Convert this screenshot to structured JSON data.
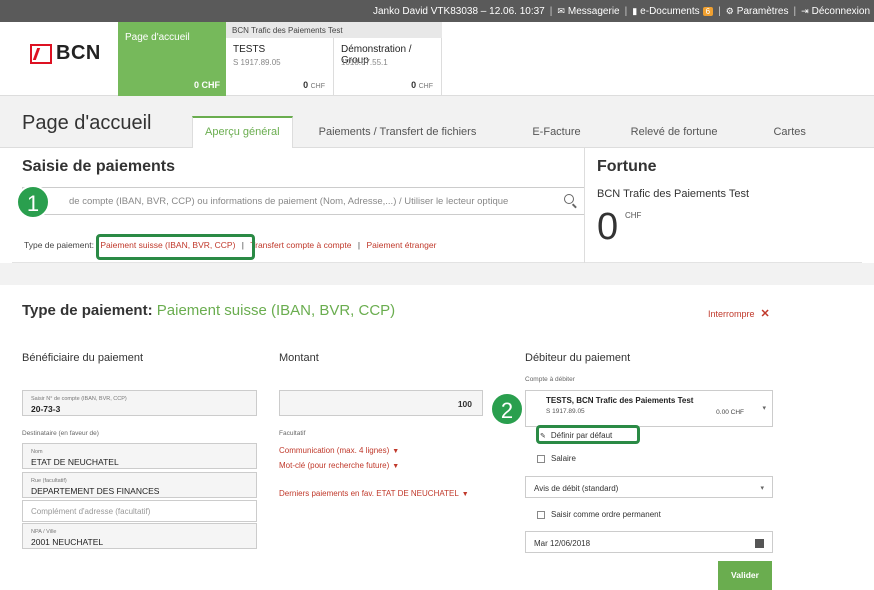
{
  "topbar": {
    "user": "Janko David VTK83038 – 12.06. 10:37",
    "messaging": "Messagerie",
    "edocuments": "e-Documents",
    "edocuments_badge": "6",
    "settings": "Paramètres",
    "logout": "Déconnexion"
  },
  "brand": {
    "logo_text": "BCN"
  },
  "accounts": {
    "home": {
      "label": "Page d'accueil",
      "amount": "0 CHF"
    },
    "group_title": "BCN Trafic des Paiements Test",
    "items": [
      {
        "name": "TESTS",
        "iban": "S 1917.89.05",
        "amount": "0",
        "currency": "CHF"
      },
      {
        "name": "Démonstration / Group",
        "iban": "1018.07.55.1",
        "amount": "0",
        "currency": "CHF"
      }
    ]
  },
  "page": {
    "title": "Page d'accueil"
  },
  "tabs": [
    {
      "label": "Aperçu général"
    },
    {
      "label": "Paiements / Transfert de fichiers"
    },
    {
      "label": "E-Facture"
    },
    {
      "label": "Relevé de fortune"
    },
    {
      "label": "Cartes"
    }
  ],
  "saisie": {
    "title": "Saisie de paiements",
    "search_placeholder": "de compte (IBAN, BVR, CCP) ou informations de paiement (Nom, Adresse,...) / Utiliser le lecteur optique",
    "step1": "1",
    "type_label": "Type de paiement:",
    "type_options": [
      "Paiement suisse (IBAN, BVR, CCP)",
      "Transfert compte à compte",
      "Paiement étranger"
    ],
    "sep": "|"
  },
  "fortune": {
    "title": "Fortune",
    "subtitle": "BCN Trafic des Paiements Test",
    "value": "0",
    "currency": "CHF"
  },
  "payment": {
    "title_prefix": "Type de paiement:",
    "title_value": "Paiement suisse (IBAN, BVR, CCP)",
    "interrupt": "Interrompre",
    "beneficiary": {
      "header": "Bénéficiaire du paiement",
      "account_label": "Saisir N° de compte (IBAN, BVR, CCP)",
      "account_value": "20-73-3",
      "recipient_label": "Destinataire (en faveur de)",
      "name_label": "Nom",
      "name_value": "ETAT DE NEUCHATEL",
      "street_label": "Rue (facultatif)",
      "street_value": "DEPARTEMENT DES FINANCES",
      "address_placeholder": "Complément d'adresse (facultatif)",
      "city_label": "NPA / Ville",
      "city_value": "2001  NEUCHATEL"
    },
    "amount": {
      "header": "Montant",
      "value": "100",
      "optional": "Facultatif",
      "communication": "Communication (max. 4 lignes)",
      "keyword": "Mot-clé (pour recherche future)",
      "last_payments": "Derniers paiements en fav. ETAT DE NEUCHATEL"
    },
    "debtor": {
      "header": "Débiteur du paiement",
      "debit_account_label": "Compte à débiter",
      "account_name": "TESTS, BCN Trafic des Paiements Test",
      "account_iban": "S 1917.89.05",
      "account_balance": "0.00 CHF",
      "step2": "2",
      "default_label": "Définir par défaut",
      "salary_label": "Salaire",
      "notice_select": "Avis de débit (standard)",
      "standing_order_label": "Saisir comme ordre permanent",
      "date_value": "Mar   12/06/2018",
      "submit": "Valider"
    }
  }
}
